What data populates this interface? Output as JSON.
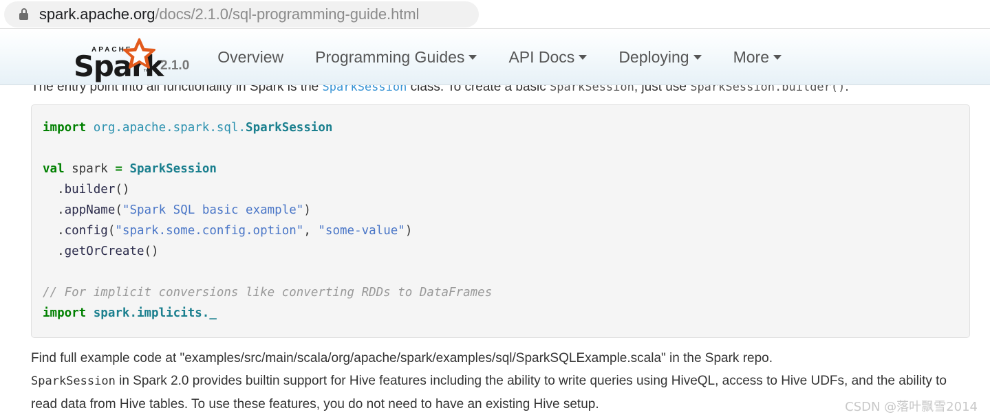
{
  "browser": {
    "lock_icon": "lock-icon",
    "url_host": "spark.apache.org",
    "url_path": "/docs/2.1.0/sql-programming-guide.html"
  },
  "navbar": {
    "brand": {
      "apache_label": "APACHE",
      "spark_label": "Spark",
      "trademark": "™",
      "star_icon": "star-icon",
      "version": "2.1.0"
    },
    "items": [
      {
        "label": "Overview",
        "has_caret": false
      },
      {
        "label": "Programming Guides",
        "has_caret": true
      },
      {
        "label": "API Docs",
        "has_caret": true
      },
      {
        "label": "Deploying",
        "has_caret": true
      },
      {
        "label": "More",
        "has_caret": true
      }
    ],
    "caret_icon": "chevron-down-icon"
  },
  "content": {
    "intro_line": {
      "part1": "The entry point into all functionality in Spark is the ",
      "code1": "SparkSession",
      "part2": " class. To create a basic ",
      "code2": "SparkSession",
      "part3": ", just use ",
      "code3": "SparkSession.builder()",
      "part4": "."
    },
    "code": {
      "language": "scala",
      "lines": [
        [
          {
            "t": "import",
            "c": "k"
          },
          {
            "t": " ",
            "c": "o"
          },
          {
            "t": "org.apache.spark.sql.",
            "c": "ns"
          },
          {
            "t": "SparkSession",
            "c": "nc"
          }
        ],
        [],
        [
          {
            "t": "val",
            "c": "k"
          },
          {
            "t": " spark ",
            "c": "o"
          },
          {
            "t": "=",
            "c": "k"
          },
          {
            "t": " ",
            "c": "o"
          },
          {
            "t": "SparkSession",
            "c": "nc"
          }
        ],
        [
          {
            "t": "  .",
            "c": "o"
          },
          {
            "t": "builder",
            "c": "m"
          },
          {
            "t": "()",
            "c": "o"
          }
        ],
        [
          {
            "t": "  .",
            "c": "o"
          },
          {
            "t": "appName",
            "c": "m"
          },
          {
            "t": "(",
            "c": "o"
          },
          {
            "t": "\"Spark SQL basic example\"",
            "c": "s"
          },
          {
            "t": ")",
            "c": "o"
          }
        ],
        [
          {
            "t": "  .",
            "c": "o"
          },
          {
            "t": "config",
            "c": "m"
          },
          {
            "t": "(",
            "c": "o"
          },
          {
            "t": "\"spark.some.config.option\"",
            "c": "s"
          },
          {
            "t": ", ",
            "c": "o"
          },
          {
            "t": "\"some-value\"",
            "c": "s"
          },
          {
            "t": ")",
            "c": "o"
          }
        ],
        [
          {
            "t": "  .",
            "c": "o"
          },
          {
            "t": "getOrCreate",
            "c": "m"
          },
          {
            "t": "()",
            "c": "o"
          }
        ],
        [],
        [
          {
            "t": "// For implicit conversions like converting RDDs to DataFrames",
            "c": "c"
          }
        ],
        [
          {
            "t": "import",
            "c": "k"
          },
          {
            "t": " ",
            "c": "o"
          },
          {
            "t": "spark.implicits._",
            "c": "nc"
          }
        ]
      ]
    },
    "paragraph_1": "Find full example code at \"examples/src/main/scala/org/apache/spark/examples/sql/SparkSQLExample.scala\" in the Spark repo.",
    "paragraph_2": {
      "code_lead": "SparkSession",
      "text": " in Spark 2.0 provides builtin support for Hive features including the ability to write queries using HiveQL, access to Hive UDFs, and the ability to read data from Hive tables. To use these features, you do not need to have an existing Hive setup."
    }
  },
  "watermark": {
    "text": "CSDN @落叶飘雪2014"
  },
  "colors": {
    "link": "#3793d4",
    "keyword": "#008000",
    "string": "#4a76c7",
    "comment": "#999999",
    "class": "#1a7f8e",
    "logo_star": "#e25a1c",
    "navbar_bottom": "#e7f1f7"
  }
}
